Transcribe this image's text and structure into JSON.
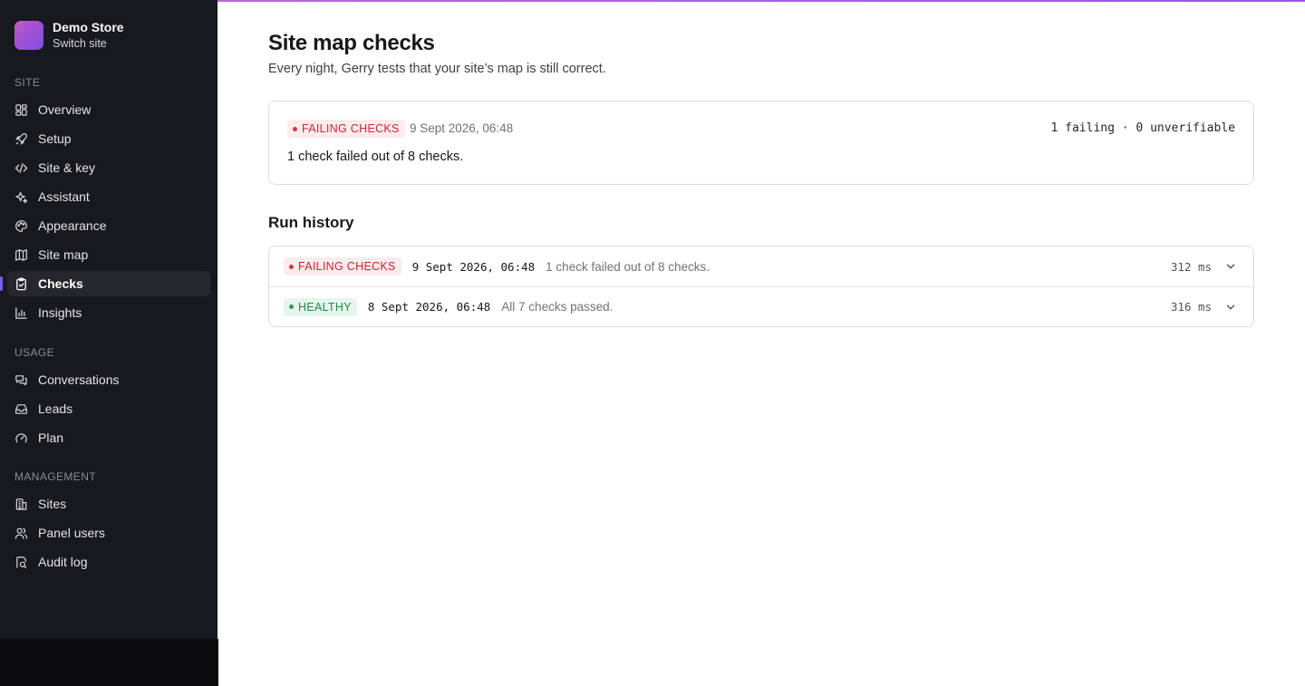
{
  "store": {
    "name": "Demo Store",
    "switch_label": "Switch site"
  },
  "sidebar": {
    "sections": [
      {
        "label": "SITE",
        "items": [
          {
            "label": "Overview",
            "icon": "grid-icon"
          },
          {
            "label": "Setup",
            "icon": "rocket-icon"
          },
          {
            "label": "Site & key",
            "icon": "code-icon"
          },
          {
            "label": "Assistant",
            "icon": "sparkles-icon"
          },
          {
            "label": "Appearance",
            "icon": "palette-icon"
          },
          {
            "label": "Site map",
            "icon": "map-icon"
          },
          {
            "label": "Checks",
            "icon": "clipboard-check-icon",
            "active": true
          },
          {
            "label": "Insights",
            "icon": "bar-chart-icon"
          }
        ]
      },
      {
        "label": "USAGE",
        "items": [
          {
            "label": "Conversations",
            "icon": "chat-icon"
          },
          {
            "label": "Leads",
            "icon": "inbox-icon"
          },
          {
            "label": "Plan",
            "icon": "gauge-icon"
          }
        ]
      },
      {
        "label": "MANAGEMENT",
        "items": [
          {
            "label": "Sites",
            "icon": "building-icon"
          },
          {
            "label": "Panel users",
            "icon": "users-icon"
          },
          {
            "label": "Audit log",
            "icon": "audit-icon"
          }
        ]
      }
    ]
  },
  "page": {
    "title": "Site map checks",
    "subtitle": "Every night, Gerry tests that your site’s map is still correct."
  },
  "status_card": {
    "badge": "FAILING CHECKS",
    "badge_status": "failing",
    "date": "9 Sept 2026, 06:48",
    "counts": "1 failing · 0 unverifiable",
    "summary": "1 check failed out of 8 checks."
  },
  "history": {
    "title": "Run history",
    "rows": [
      {
        "badge": "FAILING CHECKS",
        "status": "failing",
        "date": "9 Sept 2026, 06:48",
        "message": "1 check failed out of 8 checks.",
        "duration": "312 ms"
      },
      {
        "badge": "HEALTHY",
        "status": "healthy",
        "date": "8 Sept 2026, 06:48",
        "message": "All 7 checks passed.",
        "duration": "316 ms"
      }
    ]
  },
  "colors": {
    "sidebar_bg": "#18181f",
    "accent": "#7c5cf0",
    "failing": "#c4283a",
    "healthy": "#1f8a4c"
  }
}
